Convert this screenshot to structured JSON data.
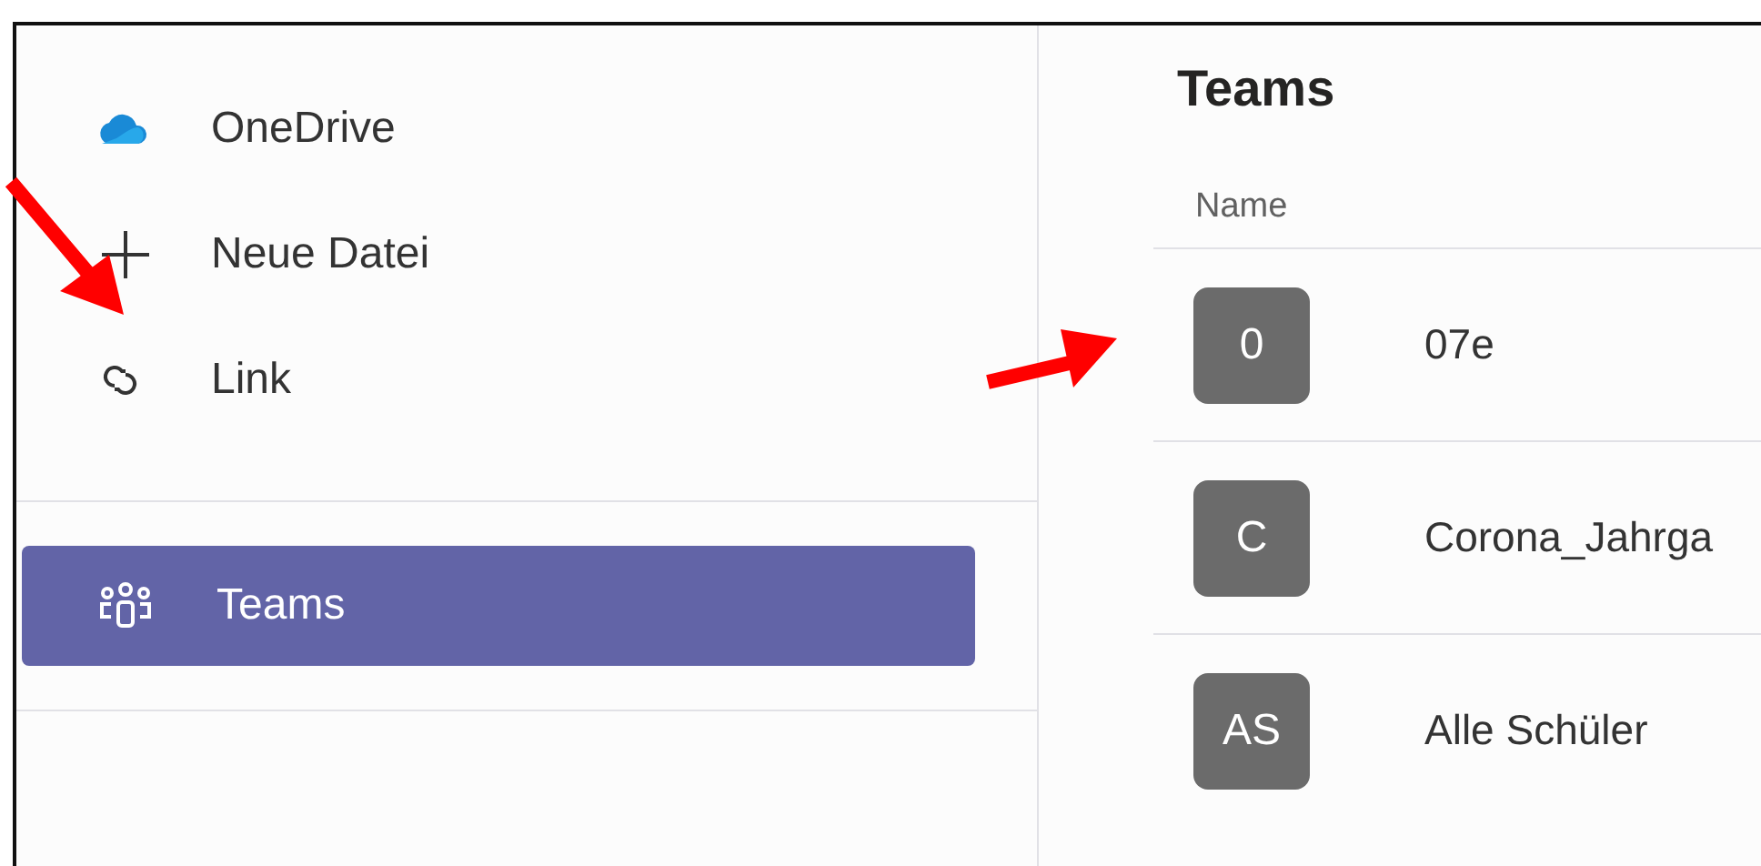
{
  "sidebar": {
    "actions": [
      {
        "label": "OneDrive"
      },
      {
        "label": "Neue Datei"
      },
      {
        "label": "Link"
      }
    ],
    "nav": [
      {
        "label": "Teams",
        "selected": true
      }
    ]
  },
  "main": {
    "title": "Teams",
    "column": "Name",
    "rows": [
      {
        "initials": "0",
        "name": "07e"
      },
      {
        "initials": "C",
        "name": "Corona_Jahrga"
      },
      {
        "initials": "AS",
        "name": "Alle Schüler"
      }
    ]
  }
}
